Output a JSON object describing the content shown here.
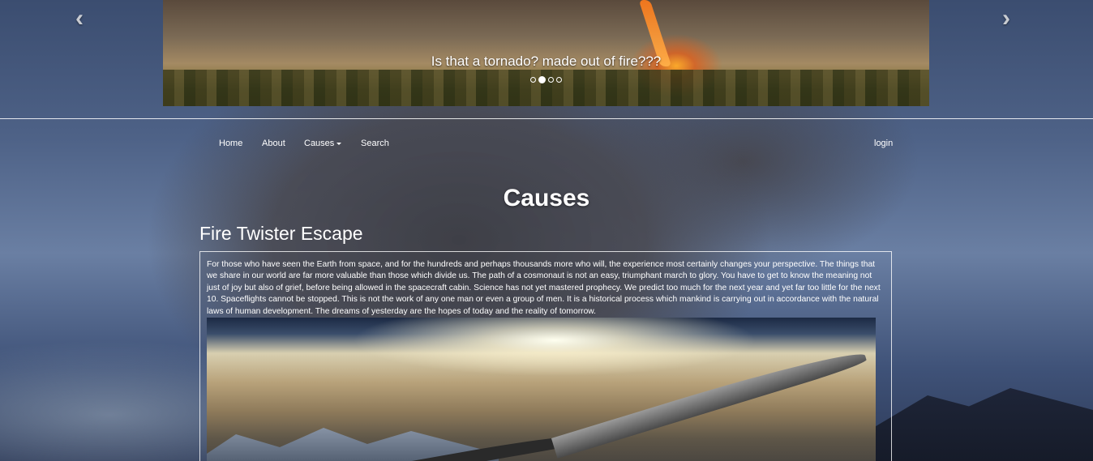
{
  "carousel": {
    "caption": "Is that a tornado? made out of fire???",
    "slide_count": 4,
    "active_index": 1,
    "prev_icon": "chevron-left-icon",
    "next_icon": "chevron-right-icon"
  },
  "nav": {
    "home": "Home",
    "about": "About",
    "causes": "Causes",
    "search": "Search",
    "login": "login"
  },
  "page": {
    "title": "Causes",
    "section_title": "Fire Twister Escape",
    "body": "For those who have seen the Earth from space, and for the hundreds and perhaps thousands more who will, the experience most certainly changes your perspective. The things that we share in our world are far more valuable than those which divide us. The path of a cosmonaut is not an easy, triumphant march to glory. You have to get to know the meaning not just of joy but also of grief, before being allowed in the spacecraft cabin. Science has not yet mastered prophecy. We predict too much for the next year and yet far too little for the next 10. Spaceflights cannot be stopped. This is not the work of any one man or even a group of men. It is a historical process which mankind is carrying out in accordance with the natural laws of human development. The dreams of yesterday are the hopes of today and the reality of tomorrow."
  },
  "colors": {
    "text": "#ffffff",
    "sky": "#4e6287"
  }
}
